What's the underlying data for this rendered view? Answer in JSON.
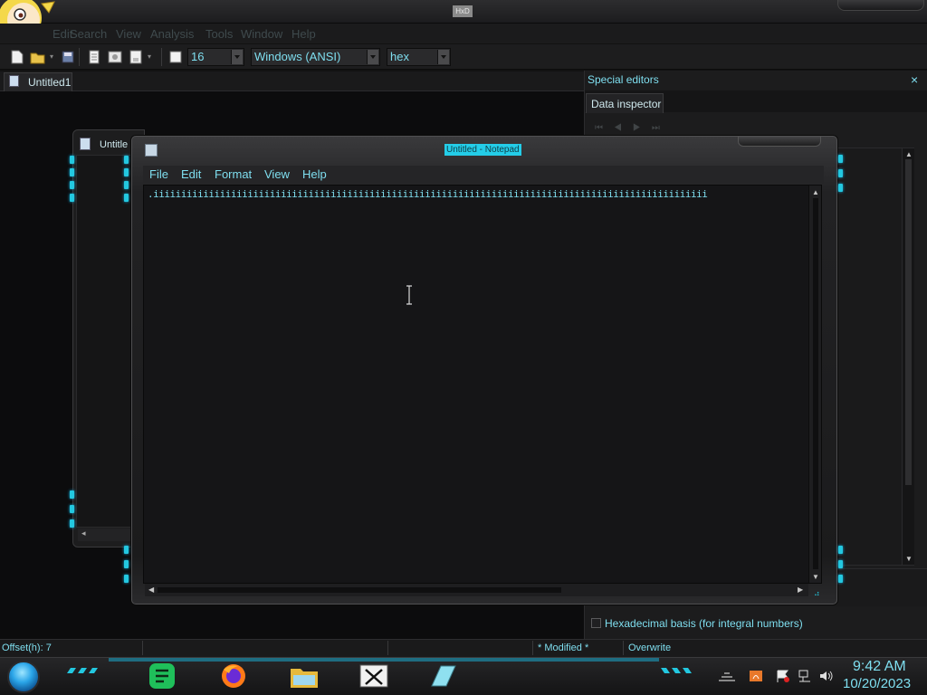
{
  "hxd": {
    "title": "HxD",
    "menu": [
      "Edit",
      "Search",
      "View",
      "Analysis",
      "Tools",
      "Window",
      "Help"
    ],
    "toolbar": {
      "bytes_per_row": "16",
      "charset": "Windows (ANSI)",
      "offset_base": "hex"
    },
    "tab_label": "Untitled1",
    "special_editors": {
      "title": "Special editors",
      "close": "×",
      "tab": "Data inspector",
      "hex_basis_label": "Hexadecimal basis (for integral numbers)"
    },
    "status": {
      "offset": "Offset(h): 7",
      "modified": "* Modified *",
      "mode": "Overwrite"
    },
    "bg_window_title": "Untitle",
    "bg_window_scroll_arrow": "◂"
  },
  "notepad": {
    "title": "Untitled - Notepad",
    "menu": [
      "File",
      "Edit",
      "Format",
      "View",
      "Help"
    ],
    "content": ".iiiiiiiiiiiiiiiiiiiiiiiiiiiiiiiiiiiiiiiiiiiiiiiiiiiiiiiiiiiiiiiiiiiiiiiiiiiiiiiiiiiiiiiiiiiiiiiiiiii"
  },
  "taskbar": {
    "time": "9:42 AM",
    "date": "10/20/2023",
    "apps": [
      "start-orb",
      "notes-app",
      "firefox",
      "file-explorer",
      "hxd",
      "notepad"
    ]
  },
  "colors": {
    "accent_cyan": "#7fdff0",
    "notch_cyan": "#23c8e0",
    "background": "#121212"
  }
}
